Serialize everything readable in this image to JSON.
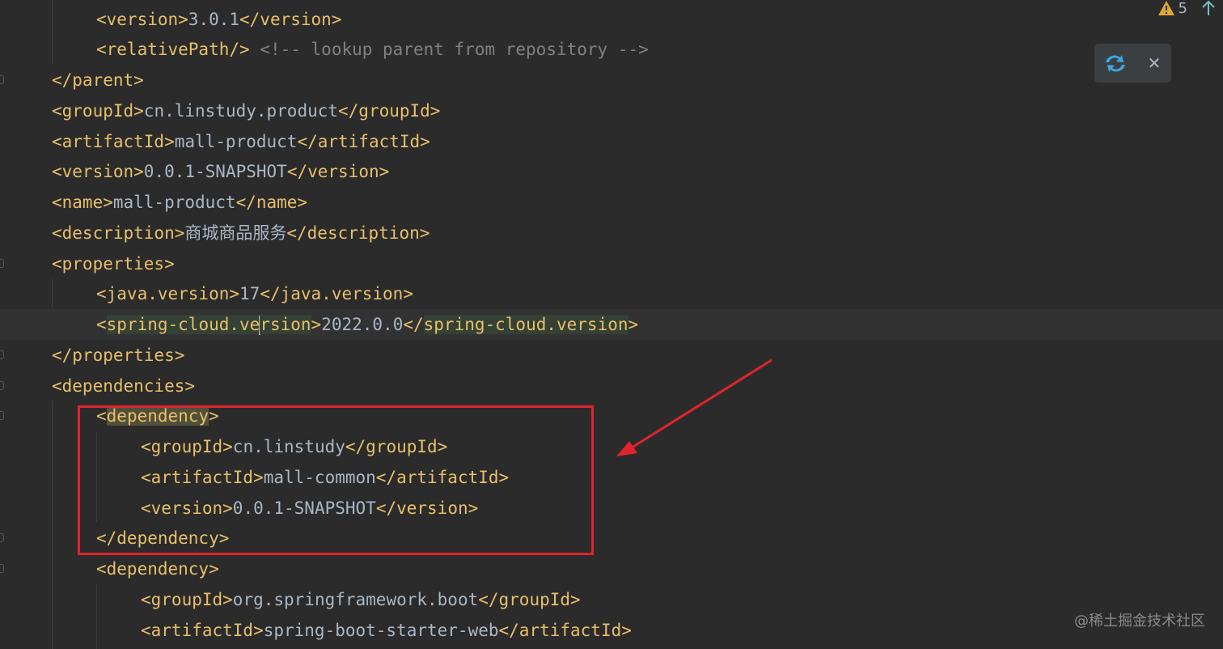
{
  "editor": {
    "lines": [
      {
        "segments": [
          {
            "c": "tag",
            "t": "<version>"
          },
          {
            "c": "txt",
            "t": "3.0.1"
          },
          {
            "c": "tag",
            "t": "</version>"
          }
        ]
      },
      {
        "segments": [
          {
            "c": "tag",
            "t": "<relativePath/>"
          },
          {
            "c": "txt",
            "t": " "
          },
          {
            "c": "cmt",
            "t": "<!-- lookup parent from repository -->"
          }
        ]
      },
      {
        "segments": [
          {
            "c": "tag",
            "t": "</parent>"
          }
        ]
      },
      {
        "segments": [
          {
            "c": "tag",
            "t": "<groupId>"
          },
          {
            "c": "txt",
            "t": "cn.linstudy.product"
          },
          {
            "c": "tag",
            "t": "</groupId>"
          }
        ]
      },
      {
        "segments": [
          {
            "c": "tag",
            "t": "<artifactId>"
          },
          {
            "c": "txt",
            "t": "mall-product"
          },
          {
            "c": "tag",
            "t": "</artifactId>"
          }
        ]
      },
      {
        "segments": [
          {
            "c": "tag",
            "t": "<version>"
          },
          {
            "c": "txt",
            "t": "0.0.1-SNAPSHOT"
          },
          {
            "c": "tag",
            "t": "</version>"
          }
        ]
      },
      {
        "segments": [
          {
            "c": "tag",
            "t": "<name>"
          },
          {
            "c": "txt",
            "t": "mall-product"
          },
          {
            "c": "tag",
            "t": "</name>"
          }
        ]
      },
      {
        "segments": [
          {
            "c": "tag",
            "t": "<description>"
          },
          {
            "c": "txt",
            "t": "商城商品服务"
          },
          {
            "c": "tag",
            "t": "</description>"
          }
        ]
      },
      {
        "segments": [
          {
            "c": "tag",
            "t": "<properties>"
          }
        ]
      },
      {
        "segments": [
          {
            "c": "tag",
            "t": "<java.version>"
          },
          {
            "c": "txt",
            "t": "17"
          },
          {
            "c": "tag",
            "t": "</java.version>"
          }
        ]
      },
      {
        "segments": [
          {
            "c": "tag",
            "t": "<"
          },
          {
            "c": "tag hl-green",
            "t": "spring-cloud.ve"
          },
          {
            "c": "caret",
            "t": ""
          },
          {
            "c": "tag hl-green",
            "t": "rsion"
          },
          {
            "c": "tag",
            "t": ">"
          },
          {
            "c": "txt",
            "t": "2022.0.0"
          },
          {
            "c": "tag",
            "t": "</"
          },
          {
            "c": "tag hl-green",
            "t": "spring-cloud.version"
          },
          {
            "c": "tag",
            "t": ">"
          }
        ]
      },
      {
        "segments": [
          {
            "c": "tag",
            "t": "</properties>"
          }
        ]
      },
      {
        "segments": [
          {
            "c": "tag",
            "t": "<dependencies>"
          }
        ]
      },
      {
        "segments": [
          {
            "c": "tag",
            "t": "<"
          },
          {
            "c": "tag hl-olive",
            "t": "dependency"
          },
          {
            "c": "tag",
            "t": ">"
          }
        ]
      },
      {
        "segments": [
          {
            "c": "tag",
            "t": "<groupId>"
          },
          {
            "c": "txt",
            "t": "cn.linstudy"
          },
          {
            "c": "tag",
            "t": "</groupId>"
          }
        ]
      },
      {
        "segments": [
          {
            "c": "tag",
            "t": "<artifactId>"
          },
          {
            "c": "txt",
            "t": "mall-common"
          },
          {
            "c": "tag",
            "t": "</artifactId>"
          }
        ]
      },
      {
        "segments": [
          {
            "c": "tag",
            "t": "<version>"
          },
          {
            "c": "txt",
            "t": "0.0.1-SNAPSHOT"
          },
          {
            "c": "tag",
            "t": "</version>"
          }
        ]
      },
      {
        "segments": [
          {
            "c": "tag",
            "t": "</dependency>"
          }
        ]
      },
      {
        "segments": [
          {
            "c": "tag",
            "t": "<dependency>"
          }
        ]
      },
      {
        "segments": [
          {
            "c": "tag",
            "t": "<groupId>"
          },
          {
            "c": "txt",
            "t": "org.springframework.boot"
          },
          {
            "c": "tag",
            "t": "</groupId>"
          }
        ]
      },
      {
        "segments": [
          {
            "c": "tag",
            "t": "<artifactId>"
          },
          {
            "c": "txt",
            "t": "spring-boot-starter-web"
          },
          {
            "c": "tag",
            "t": "</artifactId>"
          }
        ]
      }
    ]
  },
  "inspections": {
    "warning_count": "5",
    "warning_color": "#e0a82e",
    "nav_icon": "arrow-up-icon",
    "nav_color": "#6fc1c6"
  },
  "popup": {
    "sync_icon": "maven-sync-icon",
    "close_label": "✕",
    "accent": "#3aa8e0"
  },
  "annotation": {
    "color": "#e0242c"
  },
  "watermark": {
    "text": "@稀土掘金技术社区"
  }
}
